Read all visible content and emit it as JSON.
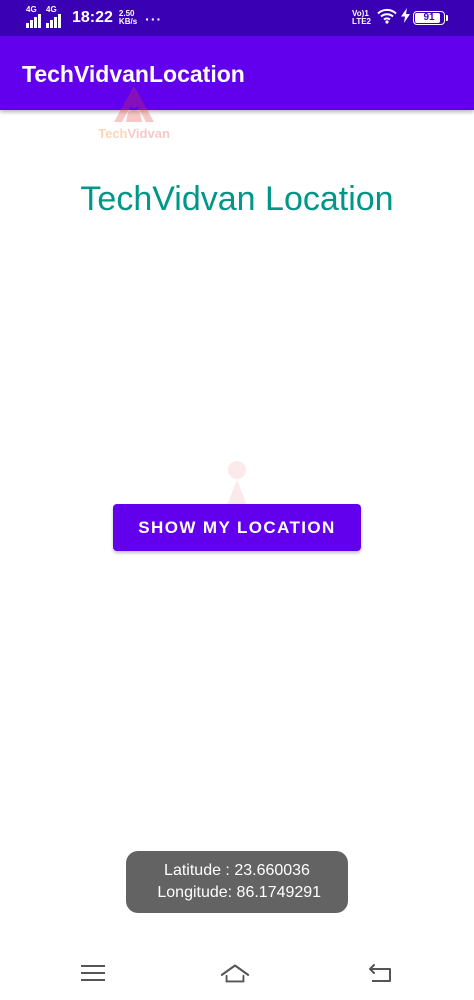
{
  "status_bar": {
    "sim1_label": "4G",
    "sim2_label": "4G",
    "time": "18:22",
    "speed_value": "2.50",
    "speed_unit": "KB/s",
    "more_dots": "···",
    "volte_top": "Vo)1",
    "volte_bottom": "LTE2",
    "battery_level": "91",
    "battery_fraction": 0.91
  },
  "app_bar": {
    "title": "TechVidvanLocation"
  },
  "watermark": {
    "text_tech": "Tech",
    "text_vidvan": "Vidvan"
  },
  "main": {
    "heading": "TechVidvan Location",
    "button_label": "SHOW MY LOCATION"
  },
  "toast": {
    "latitude": "Latitude : 23.660036",
    "longitude": " Longitude: 86.1749291"
  },
  "colors": {
    "status_bar": "#3a00b4",
    "app_bar": "#6200ee",
    "heading": "#009688",
    "button": "#6200ee",
    "toast": "#636363",
    "nav_icon": "#555555"
  },
  "icons": {
    "wifi": "wifi-icon",
    "charging": "bolt-icon",
    "battery": "battery-icon",
    "nav_menu": "menu-icon",
    "nav_home": "home-icon",
    "nav_back": "back-icon"
  }
}
